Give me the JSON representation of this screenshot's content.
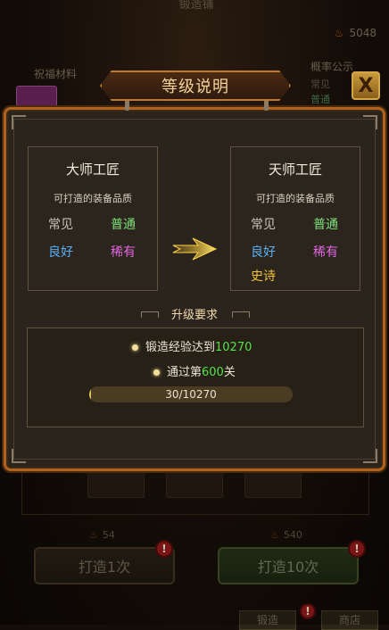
{
  "background": {
    "title": "锻造铺",
    "coin_amount": "5048",
    "left_label": "祝福材料",
    "right_label": "概率公示",
    "right_list": [
      "常见",
      "普通"
    ],
    "cost_left": "54",
    "cost_right": "540",
    "button_left": "打造1次",
    "button_right": "打造10次",
    "alert_mark": "!",
    "bottom_tabs": [
      "锻造",
      "商店"
    ]
  },
  "modal": {
    "title": "等级说明",
    "close_label": "X",
    "current_rank": {
      "name": "大师工匠",
      "subtitle": "可打造的装备品质",
      "qualities": [
        "常见",
        "普通",
        "良好",
        "稀有"
      ]
    },
    "next_rank": {
      "name": "天师工匠",
      "subtitle": "可打造的装备品质",
      "qualities": [
        "常见",
        "普通",
        "良好",
        "稀有",
        "史诗"
      ]
    },
    "requirements": {
      "heading": "升级要求",
      "exp_prefix": "锻造经验达到",
      "exp_target": "10270",
      "stage_prefix": "通过第",
      "stage_number": "600",
      "stage_suffix": "关",
      "progress_text": "30/10270",
      "progress_fraction": 0.003
    }
  },
  "colors": {
    "accent_border": "#b0621f",
    "quality_common": "#c8c2b6",
    "quality_normal": "#7fe07a",
    "quality_good": "#5ab0f2",
    "quality_rare": "#e067e0",
    "quality_epic": "#f0c23a",
    "highlight_green": "#55e04a"
  }
}
